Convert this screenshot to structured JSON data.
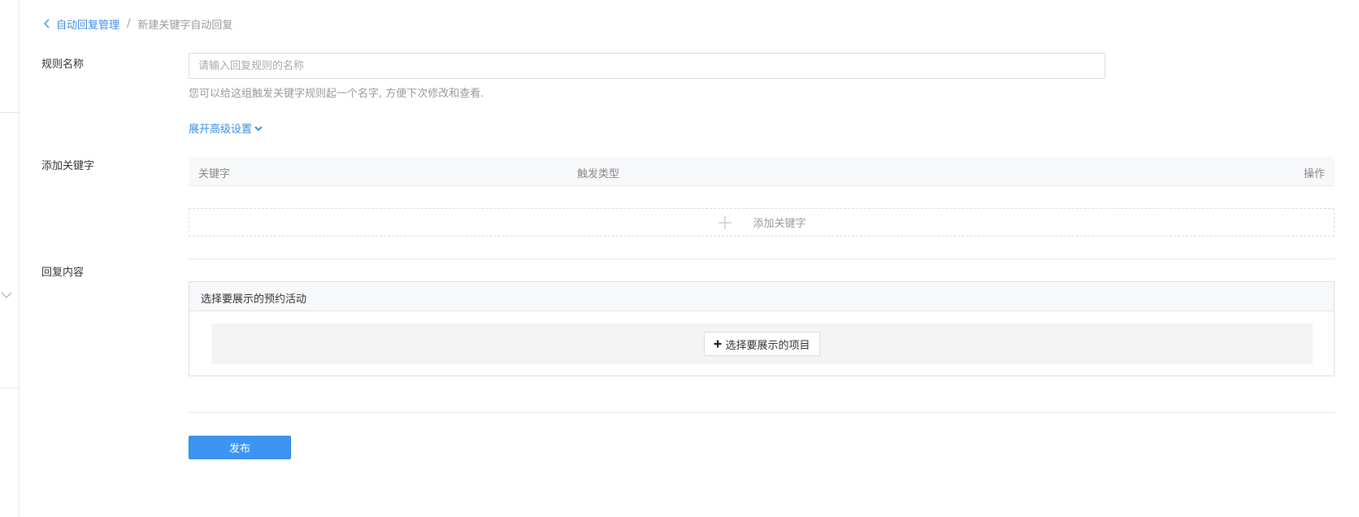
{
  "breadcrumb": {
    "back_icon": "chevron-left-icon",
    "parent": "自动回复管理",
    "separator": "/",
    "current": "新建关键字自动回复"
  },
  "form": {
    "rule_name": {
      "label": "规则名称",
      "value": "",
      "placeholder": "请输入回复规则的名称",
      "hint": "您可以给这组触发关键字规则起一个名字, 方便下次修改和查看."
    },
    "advanced_toggle": "展开高级设置",
    "keywords": {
      "label": "添加关键字",
      "columns": [
        "关键字",
        "触发类型",
        "操作"
      ],
      "rows": [],
      "add_label": "添加关键字"
    },
    "reply": {
      "label": "回复内容",
      "panel_title": "选择要展示的预约活动",
      "select_button": "选择要展示的项目"
    },
    "publish_button": "发布"
  },
  "colors": {
    "accent": "#3a8ee6",
    "primary_button": "#3a95f5"
  }
}
